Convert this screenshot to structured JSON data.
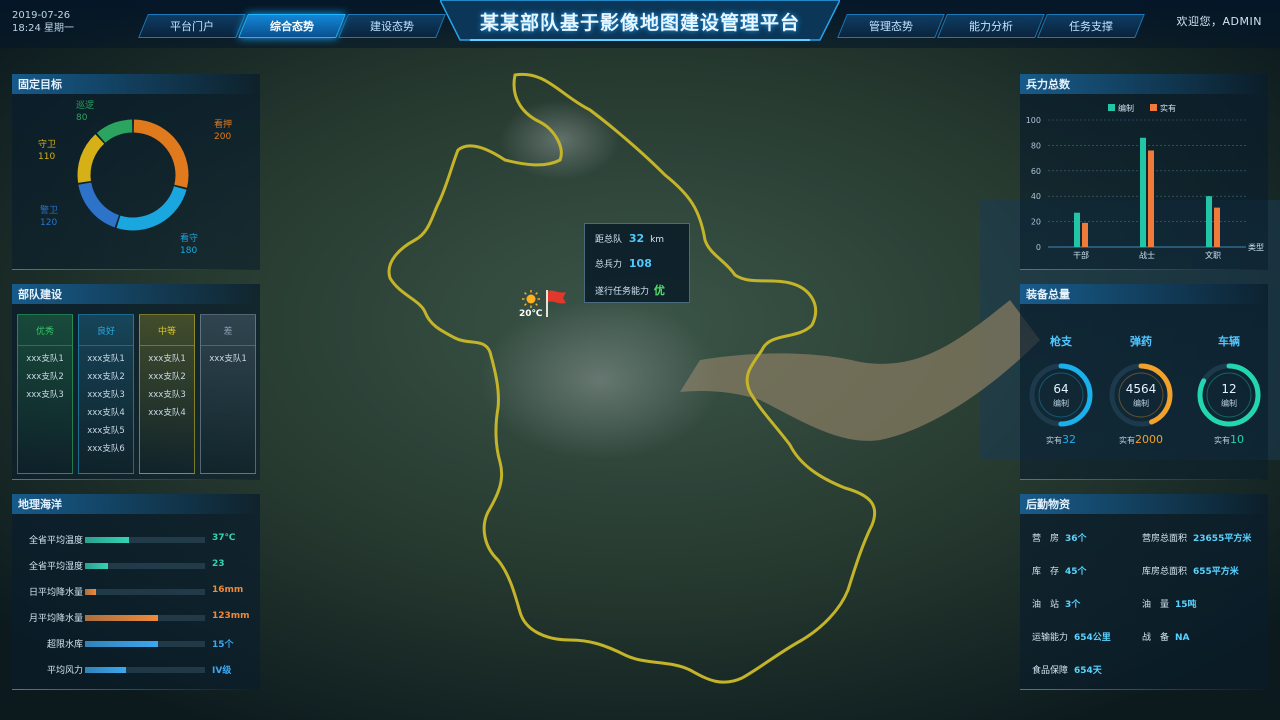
{
  "header": {
    "date": "2019-07-26",
    "time_weekday": "18:24  星期一",
    "title": "某某部队基于影像地图建设管理平台",
    "welcome": "欢迎您，ADMIN",
    "nav_left": [
      "平台门户",
      "综合态势",
      "建设态势"
    ],
    "nav_right": [
      "管理态势",
      "能力分析",
      "任务支撑"
    ],
    "active_tab": "综合态势"
  },
  "fixed_targets": {
    "title": "固定目标",
    "segments": [
      {
        "name": "看押",
        "value": 200,
        "color": "#e17a1d"
      },
      {
        "name": "看守",
        "value": 180,
        "color": "#1aa7e0"
      },
      {
        "name": "警卫",
        "value": 120,
        "color": "#2c73c9"
      },
      {
        "name": "守卫",
        "value": 110,
        "color": "#d5b017"
      },
      {
        "name": "巡逻",
        "value": 80,
        "color": "#2aa45e"
      }
    ]
  },
  "troop_construction": {
    "title": "部队建设",
    "columns": [
      {
        "grade": "优秀",
        "color": "#35c46a",
        "items": [
          "xxx支队1",
          "xxx支队2",
          "xxx支队3"
        ]
      },
      {
        "grade": "良好",
        "color": "#2aa9e0",
        "items": [
          "xxx支队1",
          "xxx支队2",
          "xxx支队3",
          "xxx支队4",
          "xxx支队5",
          "xxx支队6"
        ]
      },
      {
        "grade": "中等",
        "color": "#d6c428",
        "items": [
          "xxx支队1",
          "xxx支队2",
          "xxx支队3",
          "xxx支队4"
        ]
      },
      {
        "grade": "差",
        "color": "#8aa0b2",
        "items": [
          "xxx支队1"
        ]
      }
    ]
  },
  "geo": {
    "title": "地理海洋",
    "rows": [
      {
        "label": "全省平均温度",
        "value": "37℃",
        "fill": 0.37,
        "color": "#33d3b4"
      },
      {
        "label": "全省平均湿度",
        "value": "23",
        "fill": 0.19,
        "color": "#33d3b4"
      },
      {
        "label": "日平均降水量",
        "value": "16mm",
        "fill": 0.09,
        "color": "#f08a3a"
      },
      {
        "label": "月平均降水量",
        "value": "123mm",
        "fill": 0.61,
        "color": "#f08a3a"
      },
      {
        "label": "超限水库",
        "value": "15个",
        "fill": 0.61,
        "color": "#3aa8f0"
      },
      {
        "label": "平均风力",
        "value": "IV级",
        "fill": 0.34,
        "color": "#3aa8f0"
      }
    ]
  },
  "map": {
    "weather_temp": "20℃",
    "popup": {
      "distance_label": "距总队",
      "distance_value": "32",
      "distance_unit": "km",
      "force_label": "总兵力",
      "force_value": "108",
      "capability_label": "遂行任务能力",
      "capability_value": "优"
    }
  },
  "troop_total": {
    "title": "兵力总数",
    "chart_data": {
      "type": "bar",
      "categories": [
        "干部",
        "战士",
        "文职"
      ],
      "series": [
        {
          "name": "编制",
          "values": [
            27,
            86,
            40
          ],
          "color": "#22c6a6"
        },
        {
          "name": "实有",
          "values": [
            19,
            76,
            31
          ],
          "color": "#f07a3a"
        }
      ],
      "ylim": [
        0,
        100
      ],
      "yticks": [
        0,
        20,
        40,
        60,
        80,
        100
      ],
      "xlabel": "类型",
      "ylabel": ""
    }
  },
  "equipment": {
    "title": "装备总量",
    "items": [
      {
        "name": "枪支",
        "planned": "64",
        "planned_label": "编制",
        "actual_label": "实有",
        "actual": "32",
        "ratio": 0.5,
        "color": "#1ab0ec"
      },
      {
        "name": "弹药",
        "planned": "4564",
        "planned_label": "编制",
        "actual_label": "实有",
        "actual": "2000",
        "ratio": 0.44,
        "color": "#f2a12a"
      },
      {
        "name": "车辆",
        "planned": "12",
        "planned_label": "编制",
        "actual_label": "实有",
        "actual": "10",
        "ratio": 0.83,
        "color": "#22d6b2"
      }
    ]
  },
  "logistics": {
    "title": "后勤物资",
    "rows": [
      [
        {
          "label": "营　房",
          "value": "36个"
        },
        {
          "label": "营房总面积",
          "value": "23655平方米"
        }
      ],
      [
        {
          "label": "库　存",
          "value": "45个"
        },
        {
          "label": "库房总面积",
          "value": "655平方米"
        }
      ],
      [
        {
          "label": "油　站",
          "value": "3个"
        },
        {
          "label": "油　量",
          "value": "15吨"
        }
      ],
      [
        {
          "label": "运输能力",
          "value": "654公里"
        },
        {
          "label": "战　备",
          "value": "NA"
        }
      ],
      [
        {
          "label": "食品保障",
          "value": "654天"
        }
      ]
    ]
  }
}
